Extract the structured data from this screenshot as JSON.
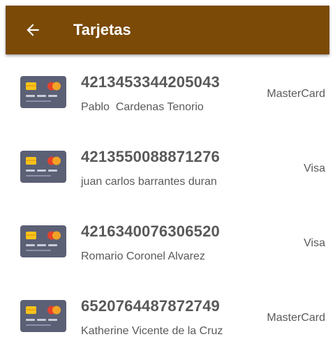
{
  "app_bar": {
    "title": "Tarjetas",
    "back_icon": "arrow-left-icon",
    "color": "#7a4a06"
  },
  "cards": [
    {
      "number": "4213453344205043",
      "holder": "Pablo  Cardenas Tenorio",
      "brand": "MasterCard",
      "icon": "credit-card-icon"
    },
    {
      "number": "4213550088871276",
      "holder": "juan carlos barrantes duran",
      "brand": "Visa",
      "icon": "credit-card-icon"
    },
    {
      "number": "4216340076306520",
      "holder": "Romario Coronel Alvarez",
      "brand": "Visa",
      "icon": "credit-card-icon"
    },
    {
      "number": "6520764487872749",
      "holder": "Katherine Vicente de la Cruz",
      "brand": "MasterCard",
      "icon": "credit-card-icon"
    }
  ],
  "icon_colors": {
    "card_body": "#5c6075",
    "chip": "#f8c21a",
    "circle_red": "#e5412c",
    "circle_orange": "#f5a623",
    "stripe": "#c9ccd8"
  }
}
